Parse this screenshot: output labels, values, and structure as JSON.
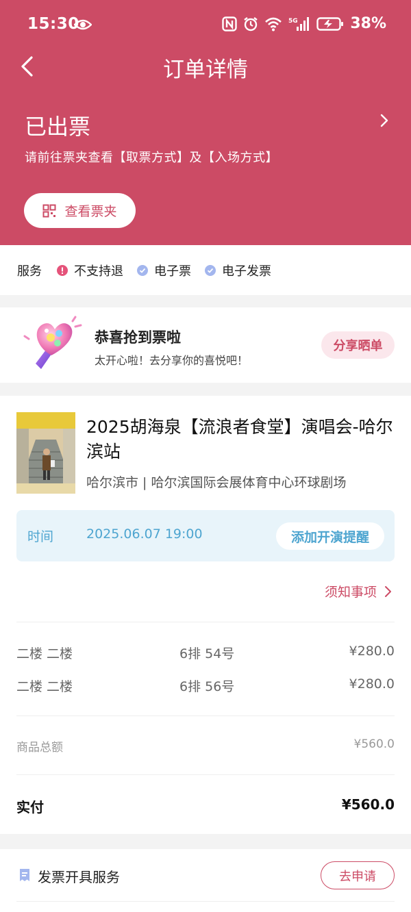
{
  "status_bar": {
    "time": "15:30",
    "battery": "38%"
  },
  "nav": {
    "title": "订单详情"
  },
  "order_status": {
    "title": "已出票",
    "description": "请前往票夹查看【取票方式】及【入场方式】",
    "wallet_button": "查看票夹"
  },
  "services": {
    "label": "服务",
    "items": [
      {
        "label": "不支持退",
        "icon": "exclamation-icon",
        "color": "#e5537a"
      },
      {
        "label": "电子票",
        "icon": "check-icon",
        "color": "#a3b6ee"
      },
      {
        "label": "电子发票",
        "icon": "check-icon",
        "color": "#a3b6ee"
      }
    ]
  },
  "congrats": {
    "title": "恭喜抢到票啦",
    "subtitle": "太开心啦！去分享你的喜悦吧！",
    "share_button": "分享晒单"
  },
  "show": {
    "title": "2025胡海泉【流浪者食堂】演唱会-哈尔滨站",
    "venue": "哈尔滨市 | 哈尔滨国际会展体育中心环球剧场",
    "time_label": "时间",
    "time_value": "2025.06.07 19:00",
    "reminder_button": "添加开演提醒",
    "notice_link": "须知事项"
  },
  "tickets": [
    {
      "area": "二楼 二楼",
      "seat": "6排 54号",
      "price": "¥280.0"
    },
    {
      "area": "二楼 二楼",
      "seat": "6排 56号",
      "price": "¥280.0"
    }
  ],
  "totals": {
    "subtotal_label": "商品总额",
    "subtotal_value": "¥560.0",
    "paid_label": "实付",
    "paid_value": "¥560.0"
  },
  "invoice": {
    "label": "发票开具服务",
    "button": "去申请"
  },
  "colors": {
    "brand": "#cc4b65",
    "accent_blue": "#4ea5d0"
  }
}
